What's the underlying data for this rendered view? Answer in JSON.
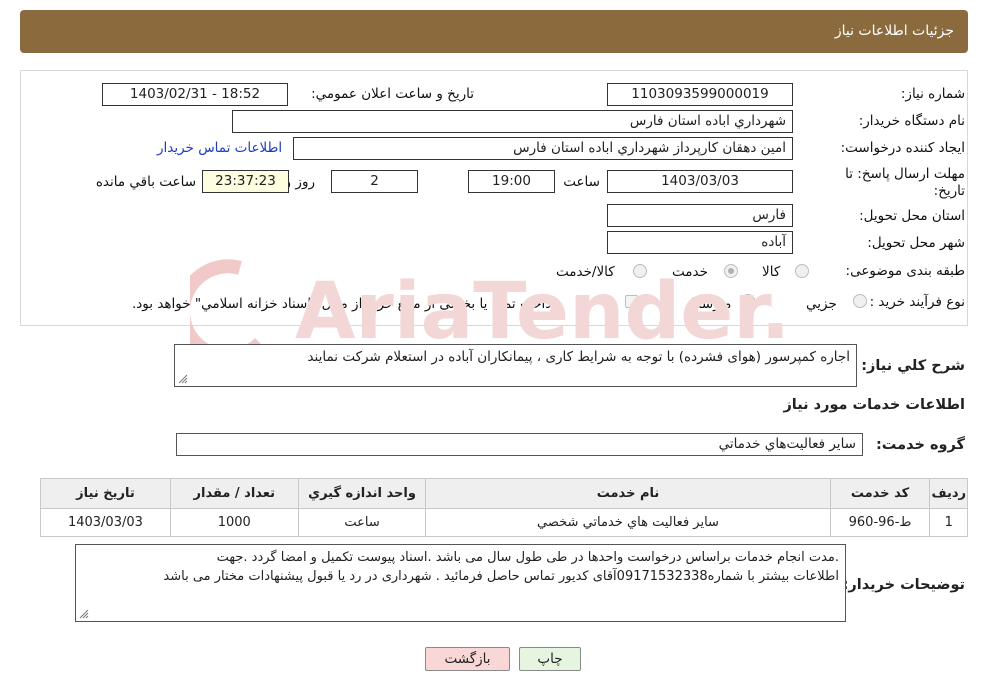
{
  "header": {
    "title": "جزئیات اطلاعات نیاز"
  },
  "fields": {
    "need_number_label": "شماره نیاز:",
    "need_number": "1103093599000019",
    "announce_label": "تاریخ و ساعت اعلان عمومي:",
    "announce_value": "1403/02/31 - 18:52",
    "buyer_org_label": "نام دستگاه خريدار:",
    "buyer_org": "شهرداري اباده استان فارس",
    "creator_label": "ايجاد کننده درخواست:",
    "creator": "امين دهقان کارپرداز شهرداري اباده استان فارس",
    "contact_link": "اطلاعات تماس خريدار",
    "deadline_label_1": "مهلت ارسال پاسخ: تا",
    "deadline_label_2": "تاريخ:",
    "deadline_date": "1403/03/03",
    "time_label": "ساعت",
    "deadline_time": "19:00",
    "days_value": "2",
    "days_label": "روز و",
    "remaining_time": "23:37:23",
    "remaining_label": "ساعت باقي مانده",
    "province_label": "استان محل تحويل:",
    "province": "فارس",
    "city_label": "شهر محل تحويل:",
    "city": "آباده",
    "category_label": "طبقه بندی موضوعی:",
    "category_options": [
      "کالا",
      "خدمت",
      "کالا/خدمت"
    ],
    "category_selected": "خدمت",
    "process_label": "نوع فرآيند خريد :",
    "process_options": [
      "جزيي",
      "متوسط"
    ],
    "payment_note": "پرداخت تمام يا بخشي از مبلغ خريد،از محل \"اسناد خزانه اسلامي\" خواهد بود."
  },
  "summary": {
    "label": "شرح كلي نياز:",
    "text": "اجاره کمپرسور (هوای فشرده) با توجه به شرایط کاری ، پیمانکاران آباده در استعلام شرکت نمایند"
  },
  "services_section_title": "اطلاعات خدمات مورد نياز",
  "service_group": {
    "label": "گروه خدمت:",
    "value": "ساير فعاليت‌هاي خدماتي"
  },
  "table": {
    "headers": [
      "رديف",
      "کد خدمت",
      "نام خدمت",
      "واحد اندازه گيري",
      "تعداد / مقدار",
      "تاريخ نياز"
    ],
    "rows": [
      [
        "1",
        "ط-96-960",
        "ساير فعاليت هاي خدماتي شخصي",
        "ساعت",
        "1000",
        "1403/03/03"
      ]
    ]
  },
  "buyer_notes": {
    "label": "توضيحات خريدار:",
    "line1": ".مدت انجام خدمات براساس درخواست واحدها در طی طول سال می باشد .اسناد پیوست تکمیل و امضا گردد .جهت",
    "line2": "اطلاعات بیشتر با شماره09171532338آقای کدیور تماس حاصل فرمائید . شهرداری در رد یا قبول پیشنهادات مختار می باشد"
  },
  "buttons": {
    "print": "چاپ",
    "back": "بازگشت"
  },
  "watermark": {
    "text": "AriaTender.net",
    "color": "#e9b3b3"
  },
  "colors": {
    "header_bg": "#8b6a3e",
    "back_button_bg": "#f9d7d7",
    "print_button_bg": "#e6f5e0"
  }
}
